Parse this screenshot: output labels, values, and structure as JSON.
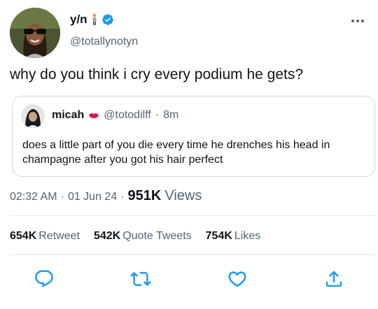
{
  "tweet": {
    "name": "y/n",
    "handle": "@totallynotyn",
    "text": "why do you think i cry every podium he gets?"
  },
  "quoted": {
    "name": "micah",
    "handle": "@totodilff",
    "separator": "·",
    "time": "8m",
    "text": "does a little part of you die every time he drenches his head in champagne after you got his hair perfect"
  },
  "meta": {
    "time": "02:32 AM",
    "sep1": "·",
    "date": "01 Jun 24",
    "sep2": "·",
    "views_count": "951K",
    "views_label": "Views"
  },
  "stats": {
    "retweets_count": "654K",
    "retweets_label": "Retweet",
    "quotes_count": "542K",
    "quotes_label": "Quote Tweets",
    "likes_count": "754K",
    "likes_label": "Likes"
  },
  "icons": {
    "verified": "verified-badge",
    "more": "more-icon",
    "reply": "reply-icon",
    "retweet": "retweet-icon",
    "like": "heart-icon",
    "share": "share-icon"
  },
  "colors": {
    "verified_blue": "#1d9bf0",
    "icon_blue": "#1d9bf0",
    "secondary_text": "#536471"
  }
}
